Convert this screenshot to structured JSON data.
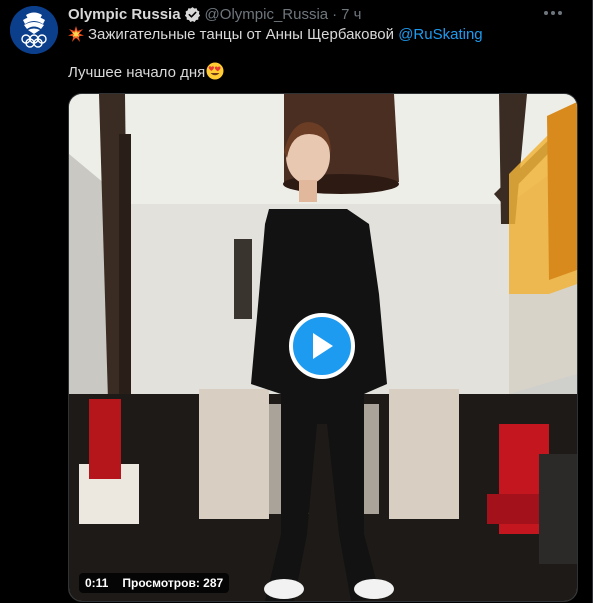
{
  "tweet": {
    "display_name": "Olympic Russia",
    "handle": "@Olympic_Russia",
    "separator": "·",
    "time": "7 ч",
    "text_line1": "Зажигательные танцы от Анны Щербаковой",
    "mention": "@RuSkating",
    "text_line2": "Лучшее начало дня",
    "emoji_line1": "collision-emoji",
    "emoji_line2": "smiling-face-heart-eyes-emoji"
  },
  "video": {
    "duration": "0:11",
    "views": "Просмотров: 287"
  },
  "icons": {
    "verified": "verified-badge-icon",
    "more": "more-horizontal-icon",
    "play": "play-icon",
    "avatar": "olympic-russia-logo"
  },
  "colors": {
    "background": "#000000",
    "text": "#d9d9d9",
    "secondary_text": "#6e767d",
    "accent": "#1d9bf0",
    "avatar_blue": "#0b3f8c"
  }
}
